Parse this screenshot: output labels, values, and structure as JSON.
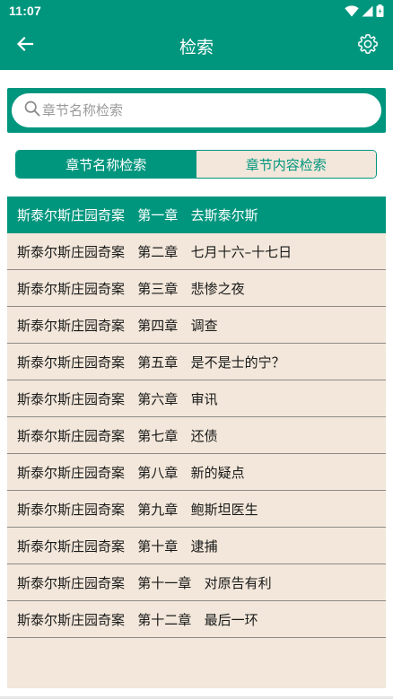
{
  "status_bar": {
    "time": "11:07",
    "icons": [
      "wifi-icon",
      "signal-icon",
      "battery-icon"
    ]
  },
  "app_bar": {
    "back_icon": "arrow-left-icon",
    "title": "检索",
    "settings_icon": "gear-icon"
  },
  "search": {
    "icon": "search-icon",
    "placeholder": "章节名称检索",
    "value": ""
  },
  "segmented_control": {
    "tabs": [
      {
        "label": "章节名称检索",
        "selected": true
      },
      {
        "label": "章节内容检索",
        "selected": false
      }
    ]
  },
  "results": [
    {
      "text": "斯泰尔斯庄园奇案   第一章   去斯泰尔斯",
      "selected": true
    },
    {
      "text": "斯泰尔斯庄园奇案   第二章   七月十六–十七日",
      "selected": false
    },
    {
      "text": "斯泰尔斯庄园奇案   第三章   悲惨之夜",
      "selected": false
    },
    {
      "text": "斯泰尔斯庄园奇案   第四章   调查",
      "selected": false
    },
    {
      "text": "斯泰尔斯庄园奇案   第五章   是不是士的宁？",
      "selected": false
    },
    {
      "text": "斯泰尔斯庄园奇案   第六章   审讯",
      "selected": false
    },
    {
      "text": "斯泰尔斯庄园奇案   第七章   还债",
      "selected": false
    },
    {
      "text": "斯泰尔斯庄园奇案   第八章   新的疑点",
      "selected": false
    },
    {
      "text": "斯泰尔斯庄园奇案   第九章   鲍斯坦医生",
      "selected": false
    },
    {
      "text": "斯泰尔斯庄园奇案   第十章   逮捕",
      "selected": false
    },
    {
      "text": "斯泰尔斯庄园奇案   第十一章   对原告有利",
      "selected": false
    },
    {
      "text": "斯泰尔斯庄园奇案   第十二章   最后一环",
      "selected": false
    }
  ],
  "colors": {
    "primary": "#00967e",
    "list_background": "#f2e7da",
    "divider": "#8e8a86"
  }
}
